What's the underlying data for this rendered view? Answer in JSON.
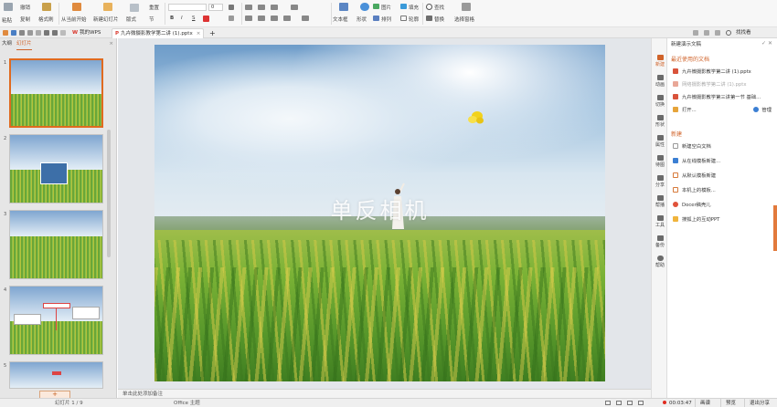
{
  "ribbon": {
    "undo_label": "撤销",
    "format_painter_label": "格式刷",
    "copy_label": "复制",
    "paste_label": "粘贴",
    "play_from_start_label": "从当前开始",
    "new_slide_label": "新建幻灯片",
    "layout_label": "版式",
    "section_label": "节",
    "reset_label": "重置",
    "font_size_value": "0",
    "bold_label": "B",
    "italic_label": "I",
    "underline_label": "S",
    "textbox_label": "文本框",
    "shape_label": "形状",
    "arrange_label": "排列",
    "image_label": "图片",
    "fill_label": "填充",
    "outline_label": "轮廓",
    "find_label": "查找",
    "replace_label": "替换",
    "select_pane_label": "选择窗格"
  },
  "tabs": {
    "my_wps_label": "我的WPS",
    "document_label": "九卉微摄影教学第二讲 (1).pptx",
    "add_tab_label": "+",
    "search_label": "找找看"
  },
  "left_panel": {
    "outline_tab_label": "大纲",
    "slides_tab_label": "幻灯片",
    "thumb_numbers": [
      "1",
      "2",
      "3",
      "4",
      "5"
    ],
    "new_slide_btn_label": "+"
  },
  "slide": {
    "title_text": "单反相机"
  },
  "notes": {
    "placeholder": "单击此处添加备注"
  },
  "rail": {
    "items": [
      "新建",
      "动画",
      "切换",
      "形状",
      "属性",
      "待图",
      "分享",
      "帮播",
      "工具",
      "备份",
      "帮助"
    ]
  },
  "task_pane": {
    "title": "新建演示文稿",
    "recent_section_label": "最近使用的文档",
    "recent_files": [
      "九卉微摄影教学第二讲 (1).pptx",
      "网络摄影教学第二讲 (1).pptx",
      "九卉微摄影教学第三讲第一节 基础..."
    ],
    "open_label": "打开...",
    "manage_label": "管理",
    "new_section_label": "新建",
    "new_items": [
      "新建空白文档",
      "从在线模板新建...",
      "从默认模板新建",
      "本机上的模板...",
      "Docer稿壳儿",
      "搜狐上的互动PPT"
    ]
  },
  "status_bar": {
    "slide_count_label": "幻灯片 1 / 9",
    "theme_label": "Office 主题",
    "timer_label": "00:03:47",
    "record_label": "画谱",
    "preview_label": "预览",
    "share_label": "退出分享"
  },
  "colors": {
    "accent": "#d0632a",
    "selected_thumb_border": "#e06a1f",
    "record_dot": "#e02b20"
  }
}
